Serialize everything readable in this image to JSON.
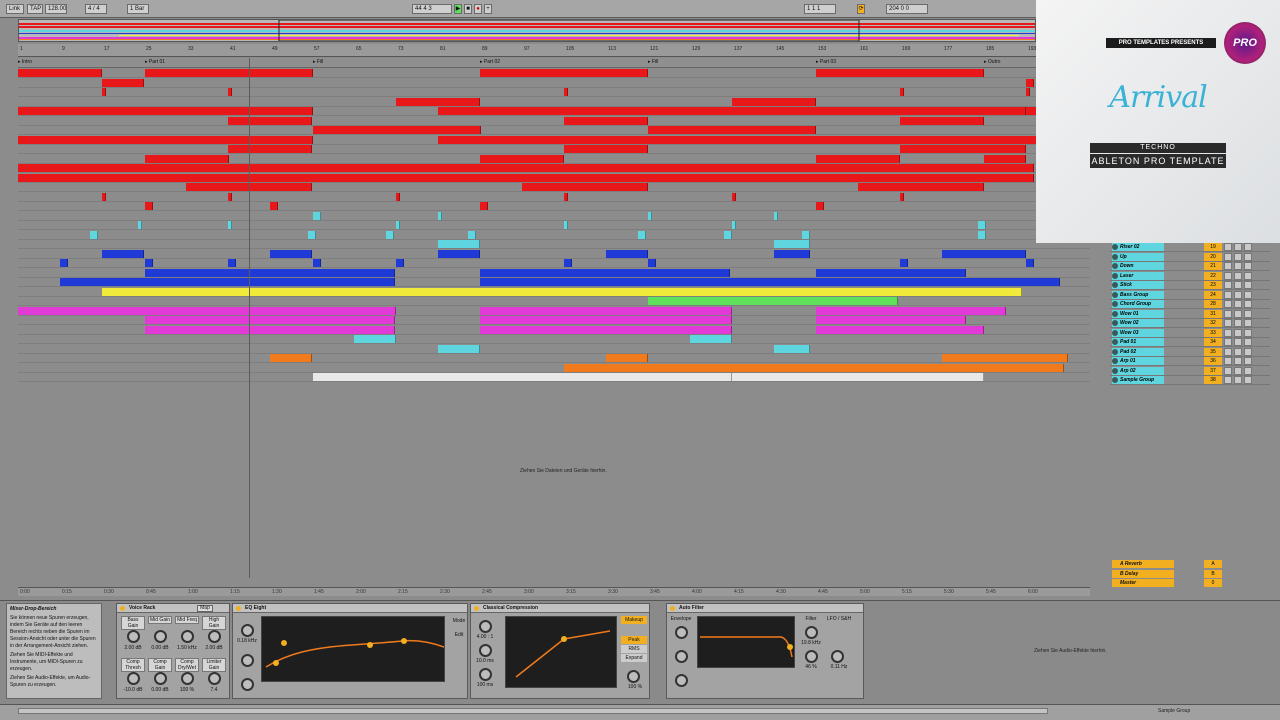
{
  "transport": {
    "link": "Link",
    "tap": "TAP",
    "tempo": "128.00",
    "signature": "4 / 4",
    "quantize": "1 Bar",
    "position": "44  4  3",
    "loop_start": "1  1  1",
    "loop_length": "204  0  0"
  },
  "locators": [
    "Intro",
    "Part 01",
    "Fill",
    "Part 02",
    "Fill",
    "Part 03",
    "Outro"
  ],
  "ruler_ticks": [
    "1",
    "9",
    "17",
    "25",
    "33",
    "41",
    "49",
    "57",
    "65",
    "73",
    "81",
    "89",
    "97",
    "105",
    "113",
    "121",
    "129",
    "137",
    "145",
    "153",
    "161",
    "169",
    "177",
    "185",
    "193"
  ],
  "bottom_times": [
    "0:00",
    "0:15",
    "0:30",
    "0:45",
    "1:00",
    "1:15",
    "1:30",
    "1:45",
    "2:00",
    "2:15",
    "2:30",
    "2:45",
    "3:00",
    "3:15",
    "3:30",
    "3:45",
    "4:00",
    "4:15",
    "4:30",
    "4:45",
    "5:00",
    "5:15",
    "5:30",
    "5:45",
    "6:00"
  ],
  "arrangement_hint": "Ziehen Sie Dateien und Geräte hierhin.",
  "tracks": [
    {
      "name": "Riser 02",
      "num": "19"
    },
    {
      "name": "Up",
      "num": "20"
    },
    {
      "name": "Down",
      "num": "21"
    },
    {
      "name": "Laser",
      "num": "22"
    },
    {
      "name": "Stick",
      "num": "23"
    },
    {
      "name": "Bass Group",
      "num": "24"
    },
    {
      "name": "Chord Group",
      "num": "28"
    },
    {
      "name": "Wow 01",
      "num": "31"
    },
    {
      "name": "Wow 02",
      "num": "32"
    },
    {
      "name": "Wow 03",
      "num": "33"
    },
    {
      "name": "Pad 01",
      "num": "34"
    },
    {
      "name": "Pad 02",
      "num": "35"
    },
    {
      "name": "Arp 01",
      "num": "36"
    },
    {
      "name": "Arp 02",
      "num": "37"
    },
    {
      "name": "Sample Group",
      "num": "38"
    }
  ],
  "returns": [
    {
      "name": "A Reverb",
      "num": "A"
    },
    {
      "name": "B Delay",
      "num": "B"
    },
    {
      "name": "Master",
      "num": "0"
    }
  ],
  "promo": {
    "presents": "PRO TEMPLATES PRESENTS",
    "logo": "PRO",
    "title": "Arrival",
    "genre": "TECHNO",
    "subtitle": "ABLETON PRO TEMPLATE"
  },
  "info": {
    "title": "Mixer-Drop-Bereich",
    "text": "Sie können neue Spuren erzeugen, indem Sie Geräte auf den leeren Bereich rechts neben die Spuren im Session-Ansicht oder unter die Spuren in der Arrangement-Ansicht ziehen.",
    "bullet1": "Ziehen Sie MIDI-Effekte und Instrumente, um MIDI-Spuren zu erzeugen.",
    "bullet2": "Ziehen Sie Audio-Effekte, um Audio-Spuren zu erzeugen."
  },
  "devices": {
    "voice_rack": "Voice Rack",
    "map": "Map",
    "macros": [
      "Bass Gain",
      "Mid Gain",
      "Mid Freq",
      "High Gain",
      "Comp Thresh",
      "Comp Gain",
      "Comp Dry/Wet",
      "Limiter Gain"
    ],
    "macro_values": [
      "2.00 dB",
      "0.00 dB",
      "1.50 kHz",
      "2.00 dB",
      "-10.0 dB",
      "0.00 dB",
      "100 %",
      "7.4"
    ],
    "eq_eight": "EQ Eight",
    "eq_mode": "Mode",
    "eq_edit": "Edit",
    "eq_freq": "0.18 kHz",
    "compressor": "Classical Compression",
    "comp_ratio": "4.00 : 1",
    "comp_attack": "10.0 ms",
    "comp_release": "100 ms",
    "comp_drywet": "100 %",
    "makeup": "Makeup",
    "peak": "Peak",
    "rms": "RMS",
    "expand": "Expand",
    "auto_filter": "Auto Filter",
    "af_envelope": "Envelope",
    "af_filter": "Filter",
    "af_lfo": "LFO / S&H",
    "af_freq": "19.8 kHz",
    "af_res": "46 %",
    "af_rate": "0.11 Hz",
    "drop_hint": "Ziehen Sie Audio-Effekte hierhin."
  },
  "status": {
    "selected": "Sample Group"
  },
  "colors": {
    "red": "#e8181a",
    "cyan": "#5fd6df",
    "blue": "#1f3ad6",
    "yellow": "#f0ea3a",
    "magenta": "#e23ad6",
    "orange": "#f07a1c",
    "green": "#5fe05a",
    "white": "#e8e8e8"
  }
}
